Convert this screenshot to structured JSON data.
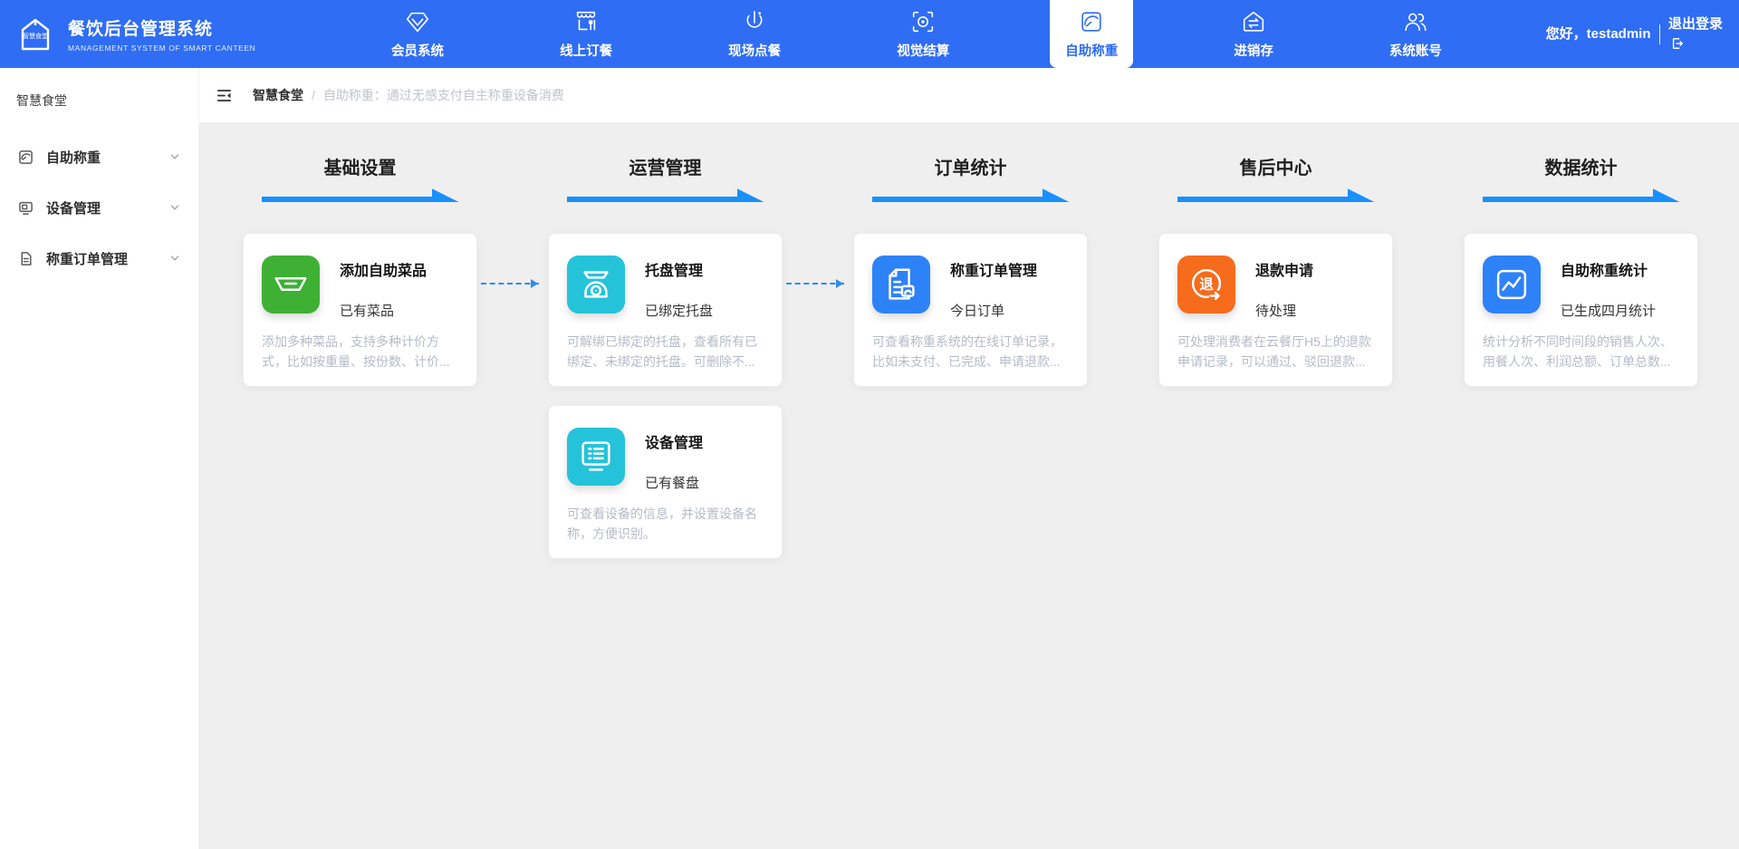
{
  "app": {
    "title": "餐饮后台管理系统",
    "subtitle": "MANAGEMENT SYSTEM OF SMART CANTEEN",
    "logo_text": "智慧食堂"
  },
  "colors": {
    "navbar_blue": "#2f6df4",
    "section_arrow_blue": "#1890ff",
    "flow_arrow_blue": "#2d8cf0",
    "main_background": "#efefef"
  },
  "navbar": {
    "items": [
      {
        "label": "会员系统",
        "icon": "gem-icon",
        "active": false
      },
      {
        "label": "线上订餐",
        "icon": "storefront-icon",
        "active": false
      },
      {
        "label": "现场点餐",
        "icon": "tap-order-icon",
        "active": false
      },
      {
        "label": "视觉结算",
        "icon": "scan-eye-icon",
        "active": false
      },
      {
        "label": "自助称重",
        "icon": "gauge-icon",
        "active": true
      },
      {
        "label": "进销存",
        "icon": "warehouse-transfer-icon",
        "active": false
      },
      {
        "label": "系统账号",
        "icon": "users-icon",
        "active": false
      }
    ],
    "greeting": "您好，testadmin",
    "logout_label": "退出登录"
  },
  "sidebar": {
    "title": "智慧食堂",
    "items": [
      {
        "label": "自助称重",
        "icon": "gauge-icon"
      },
      {
        "label": "设备管理",
        "icon": "device-icon"
      },
      {
        "label": "称重订单管理",
        "icon": "order-doc-icon"
      }
    ]
  },
  "breadcrumb": {
    "root": "智慧食堂",
    "separator": "/",
    "current": "自助称重：通过无感支付自主称重设备消费"
  },
  "main": {
    "columns": [
      {
        "header": "基础设置",
        "cards": [
          {
            "title": "添加自助菜品",
            "subtitle": "已有菜品",
            "desc": "添加多种菜品，支持多种计价方式，比如按重量、按份数、计价...",
            "color": "#3eb034",
            "icon": "dish-icon"
          }
        ]
      },
      {
        "header": "运营管理",
        "cards": [
          {
            "title": "托盘管理",
            "subtitle": "已绑定托盘",
            "desc": "可解绑已绑定的托盘，查看所有已绑定、未绑定的托盘。可删除不...",
            "color": "#25c3d9",
            "icon": "tray-scale-icon"
          },
          {
            "title": "设备管理",
            "subtitle": "已有餐盘",
            "desc": "可查看设备的信息，并设置设备名称，方便识别。",
            "color": "#25c3d9",
            "icon": "device-screen-icon"
          }
        ]
      },
      {
        "header": "订单统计",
        "cards": [
          {
            "title": "称重订单管理",
            "subtitle": "今日订单",
            "desc": "可查看称重系统的在线订单记录，比如未支付、已完成、申请退款...",
            "color": "#2e82f7",
            "icon": "order-doc-icon"
          }
        ]
      },
      {
        "header": "售后中心",
        "cards": [
          {
            "title": "退款申请",
            "subtitle": "待处理",
            "desc": "可处理消费者在云餐厅H5上的退款申请记录，可以通过、驳回退款...",
            "color": "#f76b1c",
            "icon": "refund-icon",
            "refund_glyph": "退"
          }
        ]
      },
      {
        "header": "数据统计",
        "cards": [
          {
            "title": "自助称重统计",
            "subtitle": "已生成四月统计",
            "desc": "统计分析不同时间段的销售人次、用餐人次、利润总额、订单总数...",
            "color": "#2e82f7",
            "icon": "line-chart-icon"
          }
        ]
      }
    ]
  }
}
